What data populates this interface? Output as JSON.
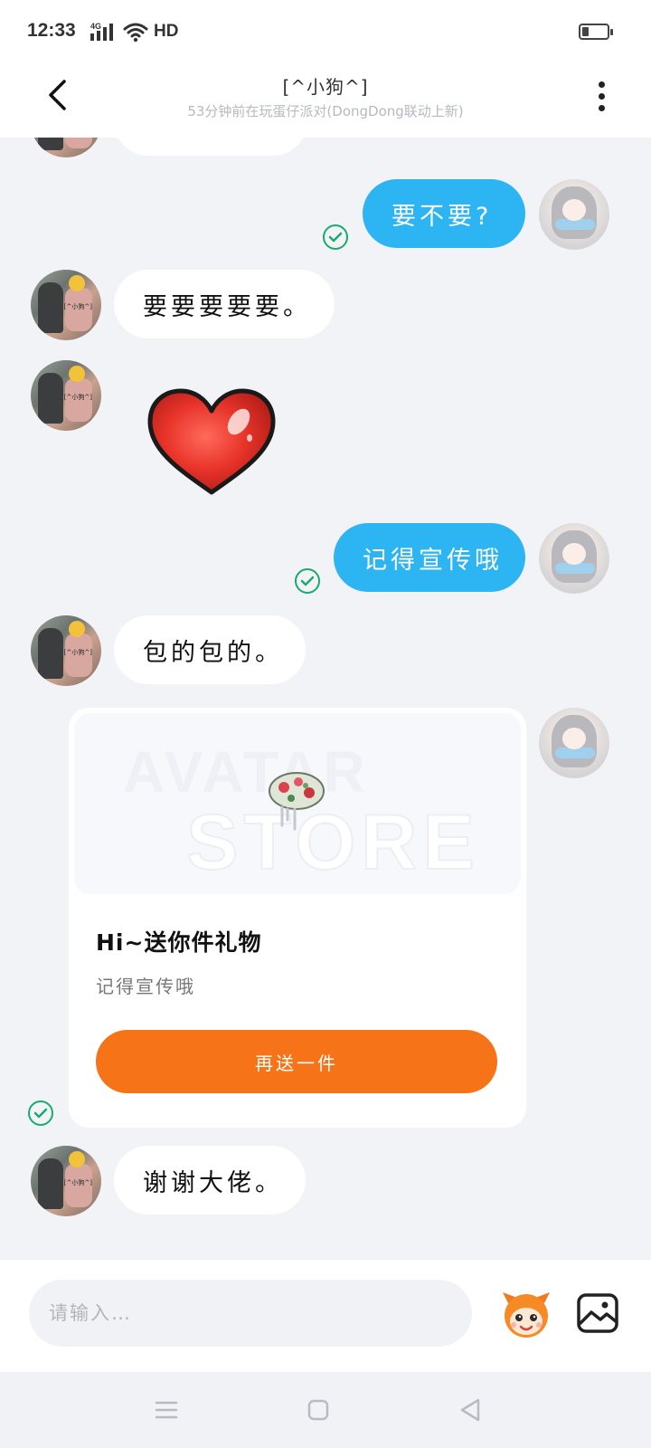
{
  "status_bar": {
    "time": "12:33",
    "network": "4G",
    "hd_label": "HD",
    "battery_percent": 25
  },
  "header": {
    "title": "[^小狗^]",
    "subtitle": "53分钟前在玩蛋仔派对(DongDong联动上新)",
    "back_icon": "chevron-left-icon",
    "more_icon": "more-vertical-icon"
  },
  "messages": [
    {
      "from": "me",
      "text": "要不要?",
      "status": "read"
    },
    {
      "from": "friend",
      "text": "要要要要要。"
    },
    {
      "from": "friend",
      "sticker": "red-heart-sticker"
    },
    {
      "from": "me",
      "text": "记得宣传哦",
      "status": "read"
    },
    {
      "from": "friend",
      "text": "包的包的。"
    },
    {
      "from": "friend",
      "text": "谢谢大佬。"
    }
  ],
  "gift_card": {
    "banner_text_line1": "AVATAR",
    "banner_text_line2": "STORE",
    "title": "Hi~送你件礼物",
    "message": "记得宣传哦",
    "button_label": "再送一件",
    "status": "read"
  },
  "input": {
    "placeholder": "请输入…",
    "value": "",
    "sticker_icon": "mascot-sticker-icon",
    "image_icon": "image-icon"
  },
  "nav": {
    "menu_icon": "menu-icon",
    "home_icon": "home-square-icon",
    "back_icon": "back-triangle-icon"
  },
  "colors": {
    "outgoing_bubble": "#2db4f3",
    "incoming_bubble": "#ffffff",
    "chat_background": "#f2f3f7",
    "read_check": "#1aab6c",
    "gift_button": "#f77318"
  }
}
